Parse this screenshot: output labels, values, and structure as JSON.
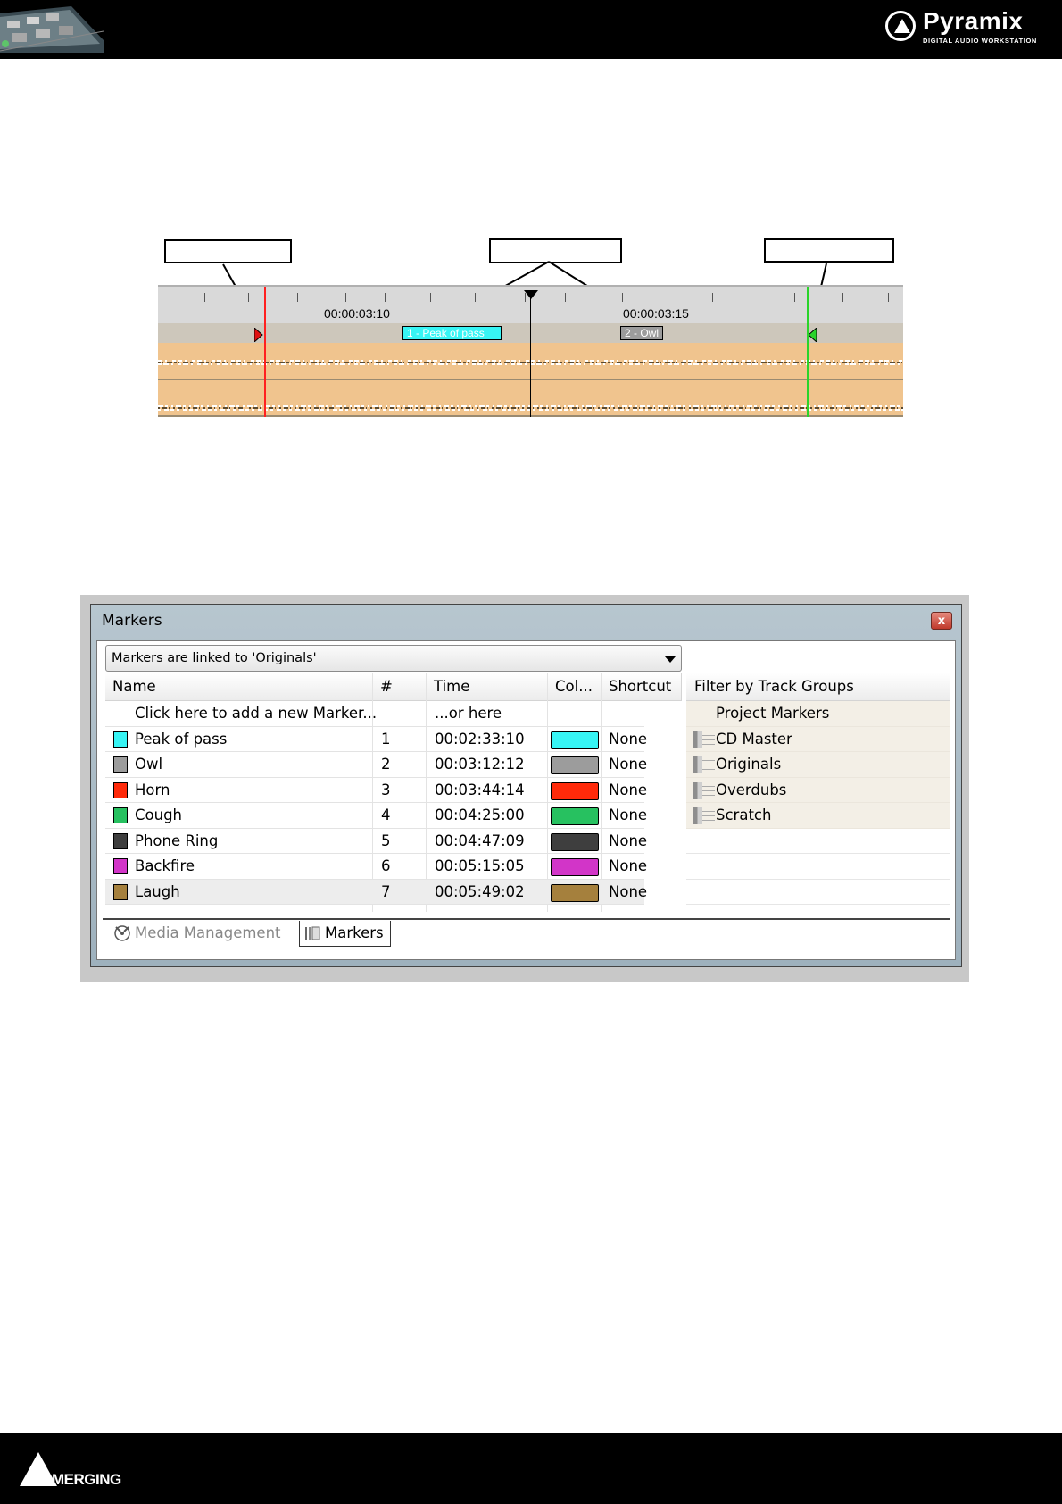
{
  "brand": {
    "name": "Pyramix",
    "subtitle": "DIGITAL AUDIO WORKSTATION"
  },
  "footer": {
    "logo_text": "MERGING"
  },
  "timeline": {
    "timecodes": [
      "00:00:03:10",
      "00:00:03:15"
    ],
    "markers": [
      {
        "label": "1 - Peak of pass",
        "color": "#37f5f5"
      },
      {
        "label": "2 - Owl",
        "color": "#9c9c9c"
      }
    ],
    "in_point_color": "#ff2020",
    "out_point_color": "#2ad42a"
  },
  "window": {
    "title": "Markers",
    "close_glyph": "x",
    "link_mode": "Markers are linked to 'Originals'",
    "columns": {
      "name": "Name",
      "number": "#",
      "time": "Time",
      "color": "Col...",
      "shortcut": "Shortcut"
    },
    "add_row": {
      "name": "Click here to add a new Marker...",
      "time": "...or here"
    },
    "rows": [
      {
        "name": "Peak of pass",
        "number": "1",
        "time": "00:02:33:10",
        "color": "#37f5f5",
        "shortcut": "None"
      },
      {
        "name": "Owl",
        "number": "2",
        "time": "00:03:12:12",
        "color": "#9c9c9c",
        "shortcut": "None"
      },
      {
        "name": "Horn",
        "number": "3",
        "time": "00:03:44:14",
        "color": "#ff2a0a",
        "shortcut": "None"
      },
      {
        "name": "Cough",
        "number": "4",
        "time": "00:04:25:00",
        "color": "#27c160",
        "shortcut": "None"
      },
      {
        "name": "Phone Ring",
        "number": "5",
        "time": "00:04:47:09",
        "color": "#3e3e3e",
        "shortcut": "None"
      },
      {
        "name": "Backfire",
        "number": "6",
        "time": "00:05:15:05",
        "color": "#d235c8",
        "shortcut": "None"
      },
      {
        "name": "Laugh",
        "number": "7",
        "time": "00:05:49:02",
        "color": "#a5803d",
        "shortcut": "None"
      }
    ],
    "filter": {
      "header": "Filter by Track Groups",
      "project_markers": "Project Markers",
      "groups": [
        "CD Master",
        "Originals",
        "Overdubs",
        "Scratch"
      ]
    },
    "tabs": {
      "media_management": "Media Management",
      "markers": "Markers"
    }
  }
}
